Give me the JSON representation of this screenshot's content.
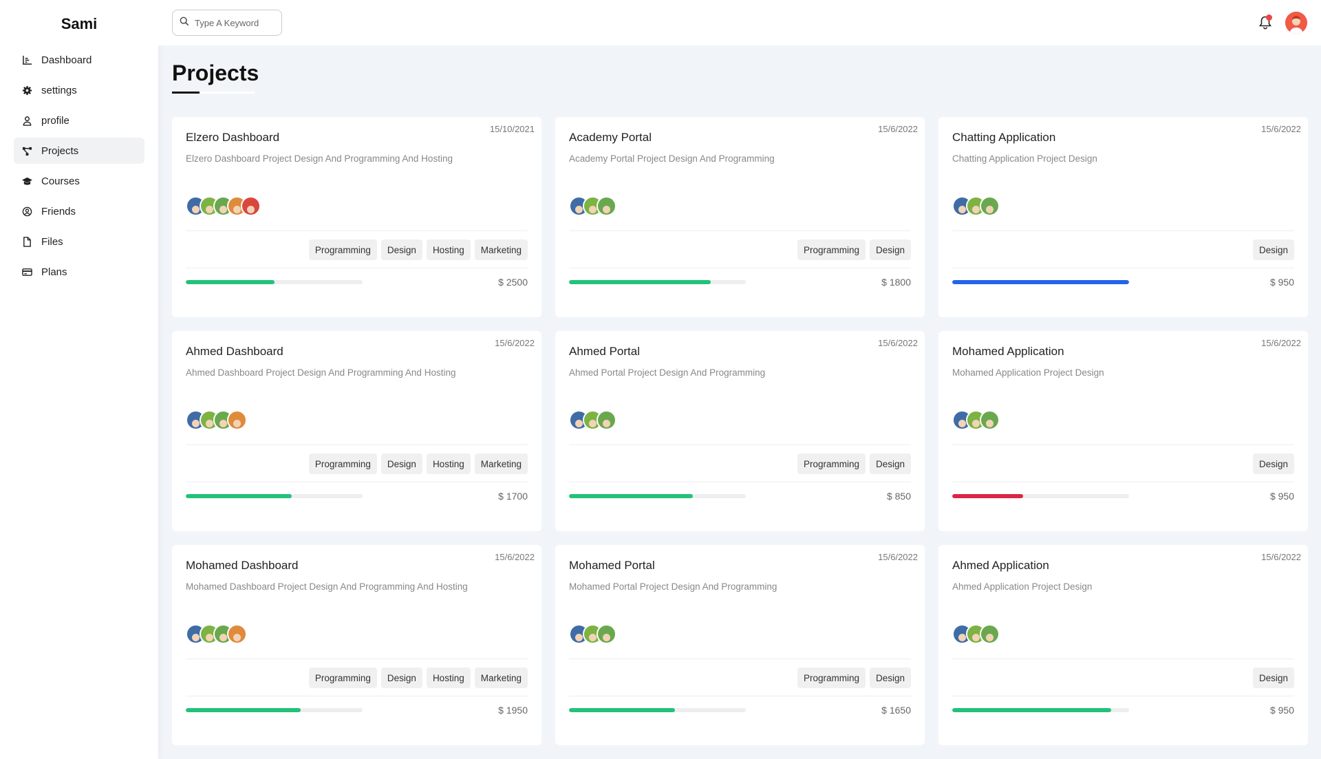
{
  "brand": "Sami",
  "sidebar": {
    "items": [
      {
        "label": "Dashboard",
        "icon": "chart-icon"
      },
      {
        "label": "settings",
        "icon": "gear-icon"
      },
      {
        "label": "profile",
        "icon": "user-icon"
      },
      {
        "label": "Projects",
        "icon": "diagram-icon",
        "active": true
      },
      {
        "label": "Courses",
        "icon": "graduation-cap-icon"
      },
      {
        "label": "Friends",
        "icon": "user-circle-icon"
      },
      {
        "label": "Files",
        "icon": "file-icon"
      },
      {
        "label": "Plans",
        "icon": "credit-card-icon"
      }
    ]
  },
  "header": {
    "search_placeholder": "Type A Keyword",
    "notification_icon": "bell-icon",
    "has_notification": true
  },
  "page": {
    "title": "Projects"
  },
  "colors": {
    "green": "#22c27a",
    "blue": "#2563eb",
    "red": "#dc2645"
  },
  "projects": [
    {
      "name": "Elzero Dashboard",
      "date": "15/10/2021",
      "desc": "Elzero Dashboard Project Design And Programming And Hosting",
      "avatars": 5,
      "tags": [
        "Programming",
        "Design",
        "Hosting",
        "Marketing"
      ],
      "progress": 0.5,
      "color": "green",
      "price": "$ 2500"
    },
    {
      "name": "Academy Portal",
      "date": "15/6/2022",
      "desc": "Academy Portal Project Design And Programming",
      "avatars": 3,
      "tags": [
        "Programming",
        "Design"
      ],
      "progress": 0.8,
      "color": "green",
      "price": "$ 1800"
    },
    {
      "name": "Chatting Application",
      "date": "15/6/2022",
      "desc": "Chatting Application Project Design",
      "avatars": 3,
      "tags": [
        "Design"
      ],
      "progress": 1.0,
      "color": "blue",
      "price": "$ 950"
    },
    {
      "name": "Ahmed Dashboard",
      "date": "15/6/2022",
      "desc": "Ahmed Dashboard Project Design And Programming And Hosting",
      "avatars": 4,
      "tags": [
        "Programming",
        "Design",
        "Hosting",
        "Marketing"
      ],
      "progress": 0.6,
      "color": "green",
      "price": "$ 1700"
    },
    {
      "name": "Ahmed Portal",
      "date": "15/6/2022",
      "desc": "Ahmed Portal Project Design And Programming",
      "avatars": 3,
      "tags": [
        "Programming",
        "Design"
      ],
      "progress": 0.7,
      "color": "green",
      "price": "$ 850"
    },
    {
      "name": "Mohamed Application",
      "date": "15/6/2022",
      "desc": "Mohamed Application Project Design",
      "avatars": 3,
      "tags": [
        "Design"
      ],
      "progress": 0.4,
      "color": "red",
      "price": "$ 950"
    },
    {
      "name": "Mohamed Dashboard",
      "date": "15/6/2022",
      "desc": "Mohamed Dashboard Project Design And Programming And Hosting",
      "avatars": 4,
      "tags": [
        "Programming",
        "Design",
        "Hosting",
        "Marketing"
      ],
      "progress": 0.65,
      "color": "green",
      "price": "$ 1950"
    },
    {
      "name": "Mohamed Portal",
      "date": "15/6/2022",
      "desc": "Mohamed Portal Project Design And Programming",
      "avatars": 3,
      "tags": [
        "Programming",
        "Design"
      ],
      "progress": 0.6,
      "color": "green",
      "price": "$ 1650"
    },
    {
      "name": "Ahmed Application",
      "date": "15/6/2022",
      "desc": "Ahmed Application Project Design",
      "avatars": 3,
      "tags": [
        "Design"
      ],
      "progress": 0.9,
      "color": "green",
      "price": "$ 950"
    }
  ]
}
